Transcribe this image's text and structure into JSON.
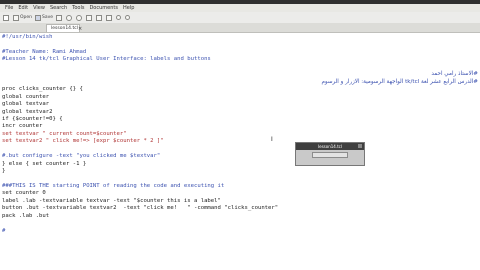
{
  "menu": [
    "File",
    "Edit",
    "View",
    "Search",
    "Tools",
    "Documents",
    "Help"
  ],
  "toolbar": {
    "new_label": "",
    "open_label": "Open",
    "save_label": "Save"
  },
  "tab": {
    "label": "lesson14.tcl"
  },
  "editor": {
    "lines": [
      {
        "text": "#!/usr/bin/wish",
        "kind": "comment",
        "row": 0
      },
      {
        "text": "#Teacher Name: Rami Ahmad",
        "kind": "comment",
        "row": 2
      },
      {
        "text": "#Lesson 14 tk/tcl Graphical User Interface: labels and buttons",
        "kind": "comment",
        "row": 3
      },
      {
        "text": "proc clicks_counter {} {",
        "kind": "plain",
        "row": 7
      },
      {
        "text": "global counter",
        "kind": "plain",
        "row": 8
      },
      {
        "text": "global textvar",
        "kind": "plain",
        "row": 9
      },
      {
        "text": "global textvar2",
        "kind": "plain",
        "row": 10
      },
      {
        "text": "if {$counter!=0} {",
        "kind": "plain",
        "row": 11
      },
      {
        "text": "incr counter",
        "kind": "plain",
        "row": 12
      },
      {
        "text": "set textvar \" current count=$counter\"",
        "kind": "string",
        "row": 13
      },
      {
        "text": "set textvar2 \" click me!=> [expr $counter * 2 ]\"",
        "kind": "string",
        "row": 14
      },
      {
        "text": "#.but configure -text \"you clicked me $textvar\"",
        "kind": "comment",
        "row": 16
      },
      {
        "text": "} else { set counter -1 }",
        "kind": "plain",
        "row": 17
      },
      {
        "text": "}",
        "kind": "plain",
        "row": 18
      },
      {
        "text": "###THIS IS THE starting POINT of reading the code and executing it",
        "kind": "comment",
        "row": 20
      },
      {
        "text": "set counter 0",
        "kind": "plain",
        "row": 21
      },
      {
        "text": "label .lab -textvariable textvar -text \"$counter this is a label\"",
        "kind": "plain",
        "row": 22
      },
      {
        "text": "button .but -textvariable textvar2  -text \"click me!   \" -command \"clicks_counter\"",
        "kind": "plain",
        "row": 23
      },
      {
        "text": "pack .lab .but",
        "kind": "plain",
        "row": 24
      },
      {
        "text": "#",
        "kind": "comment",
        "row": 26
      }
    ],
    "arabic_line_1": "#الاستاذ رامي احمد",
    "arabic_line_2": "#الدرس الرابع عشر لغة tk/tcl الواجهة الرسومية: الازرار و الرسوم"
  },
  "tk_window": {
    "title": "lesson14.tcl",
    "label_text": "",
    "button_text": ""
  },
  "colors": {
    "comment": "#3c52b0",
    "string": "#b03434",
    "plain": "#1b1b1b"
  }
}
